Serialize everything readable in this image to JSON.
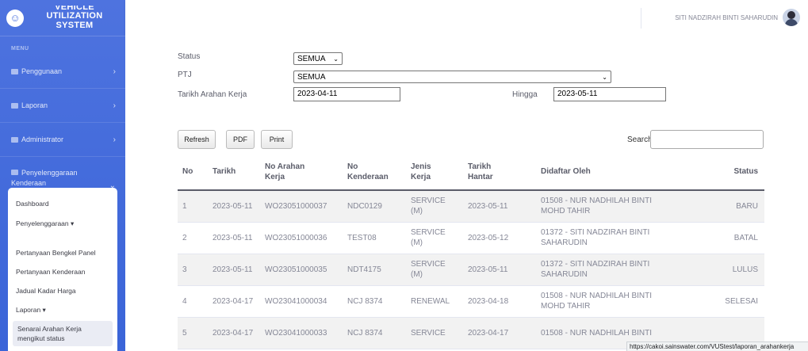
{
  "sidebar": {
    "brand_lines": [
      "VEHICLE",
      "UTILIZATION",
      "SYSTEM"
    ],
    "menu_heading": "MENU",
    "items": [
      {
        "label": "Penggunaan"
      },
      {
        "label": "Laporan"
      },
      {
        "label": "Administrator"
      },
      {
        "label_line1": "Penyelenggaraan",
        "label_line2": "Kenderaan"
      }
    ],
    "submenu": [
      "Dashboard",
      "Penyelenggaraan ▾",
      "Pertanyaan Bengkel Panel",
      "Pertanyaan Kenderaan",
      "Jadual Kadar Harga",
      "Laporan ▾"
    ],
    "submenu_active_line1": "Senarai Arahan Kerja",
    "submenu_active_line2": "mengikut status"
  },
  "topbar": {
    "user_name": "SITI NADZIRAH BINTI SAHARUDIN"
  },
  "filters": {
    "status_label": "Status",
    "status_value": "SEMUA",
    "ptj_label": "PTJ",
    "ptj_value": "SEMUA",
    "tarikh_label": "Tarikh Arahan Kerja",
    "tarikh_from": "2023-04-11",
    "hingga_label": "Hingga",
    "tarikh_to": "2023-05-11"
  },
  "toolbar": {
    "refresh": "Refresh",
    "pdf": "PDF",
    "print": "Print",
    "search_label": "Search:"
  },
  "table": {
    "headers": {
      "no": "No",
      "tarikh": "Tarikh",
      "arahan_line1": "No Arahan",
      "arahan_line2": "Kerja",
      "kenderaan_line1": "No",
      "kenderaan_line2": "Kenderaan",
      "jenis_line1": "Jenis",
      "jenis_line2": "Kerja",
      "hantar_line1": "Tarikh",
      "hantar_line2": "Hantar",
      "didaftar": "Didaftar Oleh",
      "status": "Status"
    },
    "rows": [
      {
        "no": "1",
        "tarikh": "2023-05-11",
        "arahan": "WO23051000037",
        "kenderaan": "NDC0129",
        "jenis1": "SERVICE",
        "jenis2": "(M)",
        "hantar": "2023-05-11",
        "oleh1": "01508 - NUR NADHILAH BINTI",
        "oleh2": "MOHD TAHIR",
        "status": "BARU"
      },
      {
        "no": "2",
        "tarikh": "2023-05-11",
        "arahan": "WO23051000036",
        "kenderaan": "TEST08",
        "jenis1": "SERVICE",
        "jenis2": "(M)",
        "hantar": "2023-05-12",
        "oleh1": "01372 - SITI NADZIRAH BINTI",
        "oleh2": "SAHARUDIN",
        "status": "BATAL"
      },
      {
        "no": "3",
        "tarikh": "2023-05-11",
        "arahan": "WO23051000035",
        "kenderaan": "NDT4175",
        "jenis1": "SERVICE",
        "jenis2": "(M)",
        "hantar": "2023-05-11",
        "oleh1": "01372 - SITI NADZIRAH BINTI",
        "oleh2": "SAHARUDIN",
        "status": "LULUS"
      },
      {
        "no": "4",
        "tarikh": "2023-04-17",
        "arahan": "WO23041000034",
        "kenderaan": "NCJ 8374",
        "jenis1": "RENEWAL",
        "jenis2": "",
        "hantar": "2023-04-18",
        "oleh1": "01508 - NUR NADHILAH BINTI",
        "oleh2": "MOHD TAHIR",
        "status": "SELESAI"
      },
      {
        "no": "5",
        "tarikh": "2023-04-17",
        "arahan": "WO23041000033",
        "kenderaan": "NCJ 8374",
        "jenis1": "SERVICE",
        "jenis2": "",
        "hantar": "2023-04-17",
        "oleh1": "01508 - NUR NADHILAH BINTI",
        "oleh2": "",
        "status": ""
      }
    ]
  },
  "statusbar_url": "https://cakoi.sainswater.com/VUStest/laporan_arahankerja",
  "colors": {
    "sidebar": "#4e73df",
    "text": "#5a5c69",
    "muted": "#858796"
  }
}
